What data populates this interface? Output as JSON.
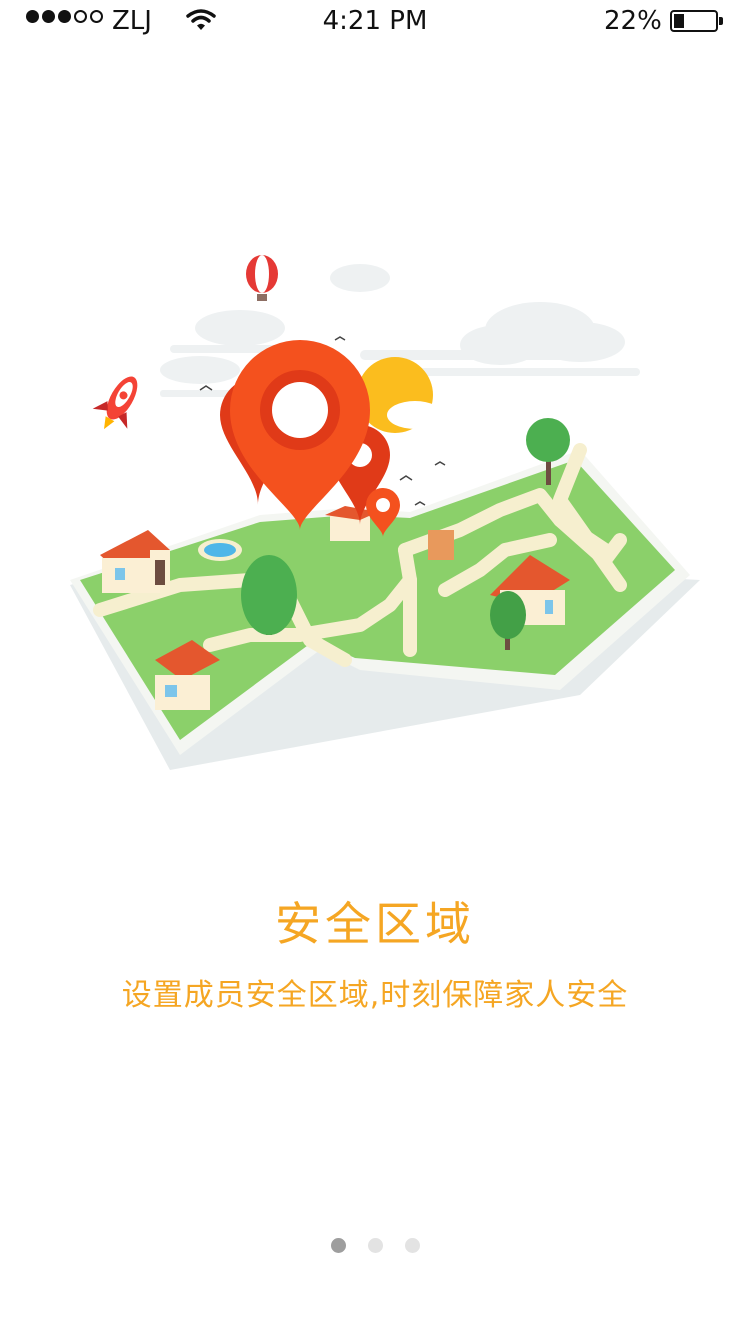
{
  "status_bar": {
    "carrier": "ZLJ",
    "time": "4:21 PM",
    "battery_percent": "22%",
    "signal_bars_filled": 3,
    "signal_bars_total": 5,
    "battery_level": 0.22
  },
  "onboarding": {
    "title": "安全区域",
    "subtitle": "设置成员安全区域,时刻保障家人安全",
    "illustration_icon": "safe-zone-map-illustration",
    "accent_color": "#F5A623"
  },
  "pager": {
    "pages": 3,
    "active_index": 0
  }
}
